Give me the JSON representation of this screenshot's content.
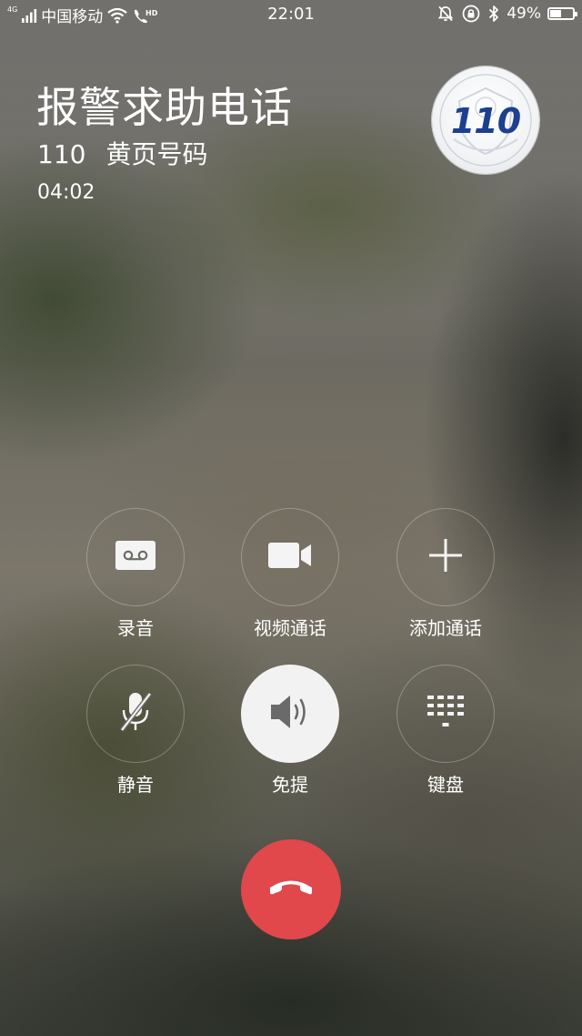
{
  "status_bar": {
    "network_type": "4G",
    "carrier": "中国移动",
    "hd_label": "HD",
    "time": "22:01",
    "battery_percent": "49%",
    "battery_level": 0.49,
    "icons": [
      "signal-icon",
      "wifi-icon",
      "hd-call-icon",
      "mute-bell-icon",
      "rotation-lock-icon",
      "bluetooth-icon",
      "battery-icon"
    ]
  },
  "call": {
    "name": "报警求助电话",
    "number": "110",
    "tag": "黄页号码",
    "duration": "04:02",
    "avatar_text": "110"
  },
  "controls": [
    {
      "label": "录音",
      "icon": "record-icon",
      "active": false
    },
    {
      "label": "视频通话",
      "icon": "video-call-icon",
      "active": false
    },
    {
      "label": "添加通话",
      "icon": "add-call-icon",
      "active": false
    },
    {
      "label": "静音",
      "icon": "mic-muted-icon",
      "active": false
    },
    {
      "label": "免提",
      "icon": "speaker-icon",
      "active": true
    },
    {
      "label": "键盘",
      "icon": "dialpad-icon",
      "active": false
    }
  ],
  "hangup": {
    "icon": "end-call-icon"
  },
  "colors": {
    "hangup": "#e0484c",
    "avatar_text": "#1d3f8f",
    "active_button": "#f2f2f2"
  }
}
